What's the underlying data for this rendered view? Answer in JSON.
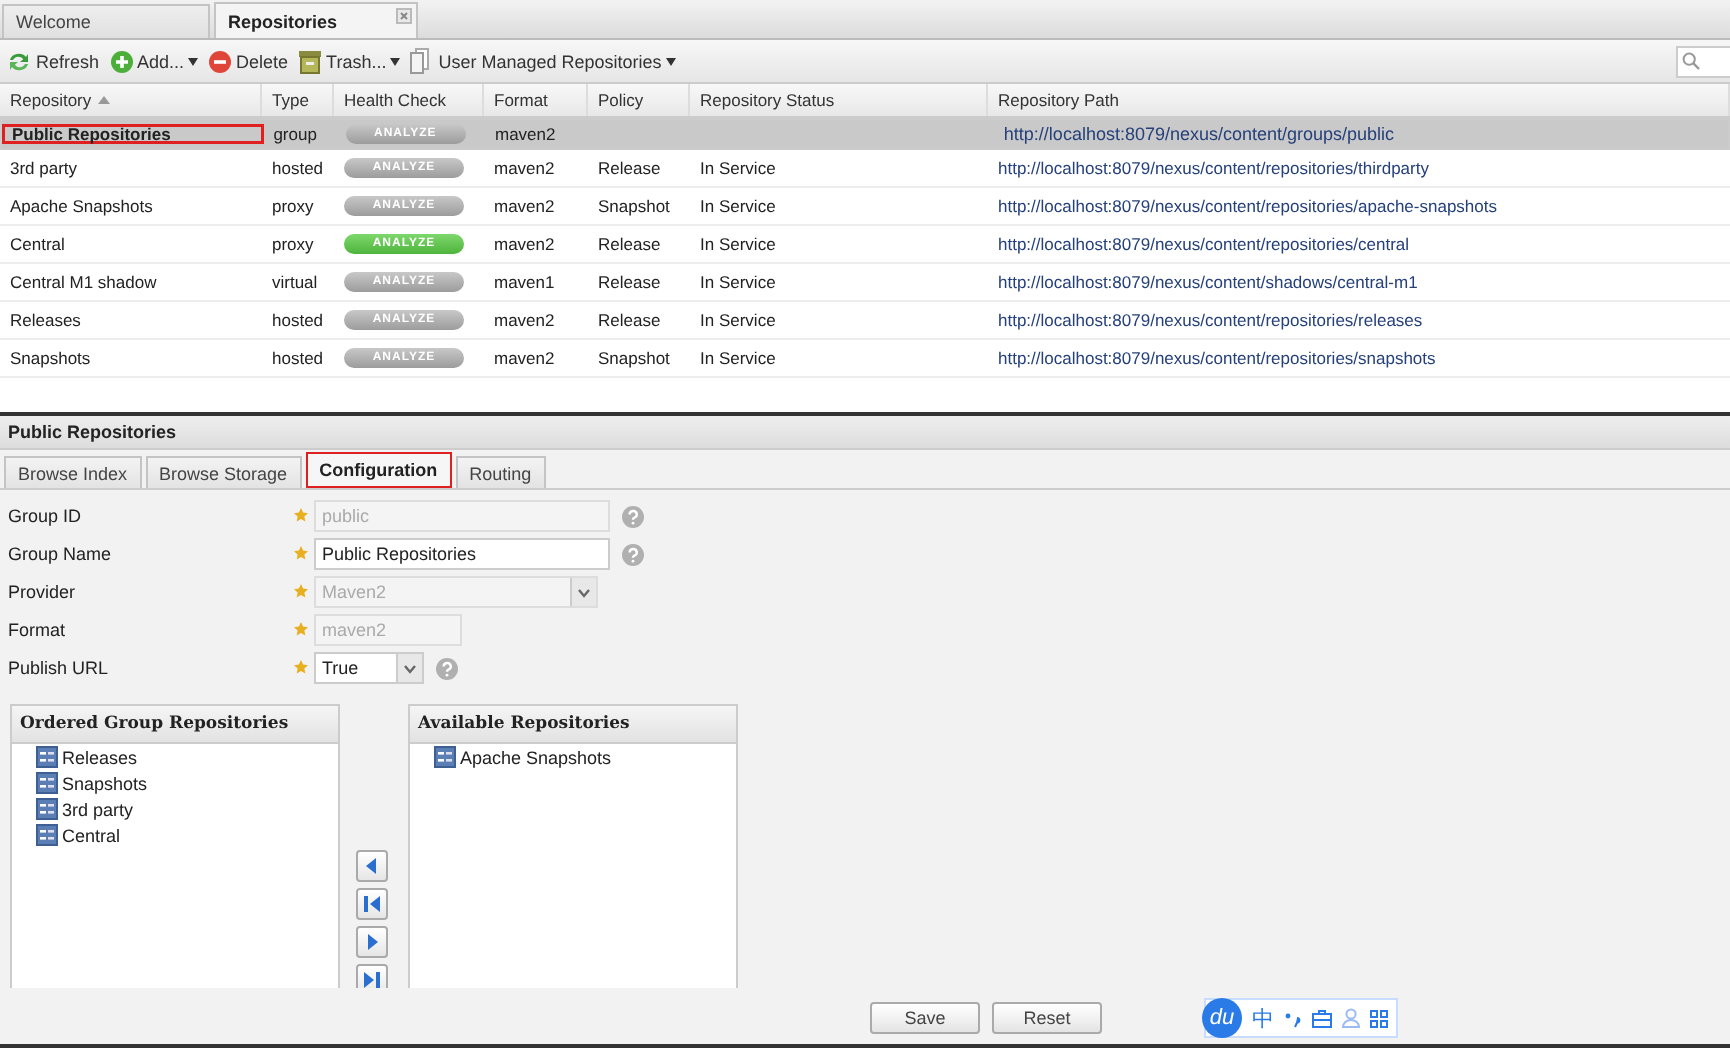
{
  "tabs": [
    {
      "label": "Welcome",
      "selected": false,
      "closable": false
    },
    {
      "label": "Repositories",
      "selected": true,
      "closable": true
    }
  ],
  "toolbar": [
    {
      "label": "Refresh",
      "kind": "refresh",
      "menu": false
    },
    {
      "label": "Add...",
      "kind": "add",
      "menu": true
    },
    {
      "label": "Delete",
      "kind": "delete",
      "menu": false
    },
    {
      "label": "Trash...",
      "kind": "trash",
      "menu": true
    },
    {
      "label": "User Managed Repositories",
      "kind": "document",
      "menu": true
    }
  ],
  "grid": {
    "columns": [
      {
        "label": "Repository",
        "sorted": true
      },
      {
        "label": "Type",
        "sorted": false
      },
      {
        "label": "Health Check",
        "sorted": false
      },
      {
        "label": "Format",
        "sorted": false
      },
      {
        "label": "Policy",
        "sorted": false
      },
      {
        "label": "Repository Status",
        "sorted": false
      },
      {
        "label": "Repository Path",
        "sorted": false
      }
    ],
    "rows": [
      {
        "name": "Public Repositories",
        "type": "group",
        "health": "ANALYZE",
        "healthy": false,
        "format": "maven2",
        "policy": "",
        "status": "",
        "path": "http://localhost:8079/nexus/content/groups/public",
        "selected": true,
        "highlighted": true
      },
      {
        "name": "3rd party",
        "type": "hosted",
        "health": "ANALYZE",
        "healthy": false,
        "format": "maven2",
        "policy": "Release",
        "status": "In Service",
        "path": "http://localhost:8079/nexus/content/repositories/thirdparty",
        "selected": false,
        "highlighted": false
      },
      {
        "name": "Apache Snapshots",
        "type": "proxy",
        "health": "ANALYZE",
        "healthy": false,
        "format": "maven2",
        "policy": "Snapshot",
        "status": "In Service",
        "path": "http://localhost:8079/nexus/content/repositories/apache-snapshots",
        "selected": false,
        "highlighted": false
      },
      {
        "name": "Central",
        "type": "proxy",
        "health": "ANALYZE",
        "healthy": true,
        "format": "maven2",
        "policy": "Release",
        "status": "In Service",
        "path": "http://localhost:8079/nexus/content/repositories/central",
        "selected": false,
        "highlighted": false
      },
      {
        "name": "Central M1 shadow",
        "type": "virtual",
        "health": "ANALYZE",
        "healthy": false,
        "format": "maven1",
        "policy": "Release",
        "status": "In Service",
        "path": "http://localhost:8079/nexus/content/shadows/central-m1",
        "selected": false,
        "highlighted": false
      },
      {
        "name": "Releases",
        "type": "hosted",
        "health": "ANALYZE",
        "healthy": false,
        "format": "maven2",
        "policy": "Release",
        "status": "In Service",
        "path": "http://localhost:8079/nexus/content/repositories/releases",
        "selected": false,
        "highlighted": false
      },
      {
        "name": "Snapshots",
        "type": "hosted",
        "health": "ANALYZE",
        "healthy": false,
        "format": "maven2",
        "policy": "Snapshot",
        "status": "In Service",
        "path": "http://localhost:8079/nexus/content/repositories/snapshots",
        "selected": false,
        "highlighted": false
      }
    ]
  },
  "detail": {
    "title": "Public Repositories",
    "tabs": [
      {
        "label": "Browse Index",
        "selected": false,
        "highlighted": false
      },
      {
        "label": "Browse Storage",
        "selected": false,
        "highlighted": false
      },
      {
        "label": "Configuration",
        "selected": true,
        "highlighted": true
      },
      {
        "label": "Routing",
        "selected": false,
        "highlighted": false
      }
    ],
    "fields": [
      {
        "label": "Group ID",
        "kind": "text",
        "value": "public",
        "required": true,
        "disabled": true,
        "help": true
      },
      {
        "label": "Group Name",
        "kind": "text",
        "value": "Public Repositories",
        "required": true,
        "disabled": false,
        "help": true
      },
      {
        "label": "Provider",
        "kind": "select",
        "value": "Maven2",
        "required": true,
        "disabled": true,
        "help": false
      },
      {
        "label": "Format",
        "kind": "text",
        "value": "maven2",
        "required": true,
        "disabled": true,
        "help": false
      },
      {
        "label": "Publish URL",
        "kind": "select",
        "value": "True",
        "required": true,
        "disabled": false,
        "help": true
      }
    ],
    "ordered": {
      "title": "Ordered Group Repositories",
      "items": [
        "Releases",
        "Snapshots",
        "3rd party",
        "Central"
      ]
    },
    "available": {
      "title": "Available Repositories",
      "items": [
        "Apache Snapshots"
      ]
    },
    "buttons": [
      "Save",
      "Reset"
    ]
  },
  "ime": {
    "logo": "du",
    "mode": "中"
  }
}
